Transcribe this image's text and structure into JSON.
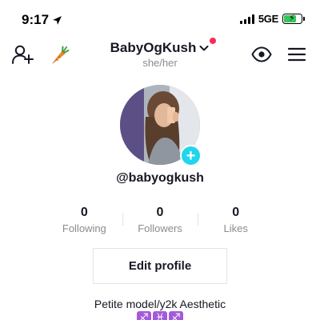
{
  "status_bar": {
    "time": "9:17",
    "network": "5GE",
    "battery_level": 0.7,
    "battery_color": "#34c759"
  },
  "header": {
    "username": "BabyOgKush",
    "pronouns": "she/her",
    "icons": [
      "add-friend-icon",
      "carrot-icon",
      "chevron-down-icon",
      "eye-icon",
      "menu-icon"
    ],
    "notification_dot_color": "#fe2c55"
  },
  "profile": {
    "handle": "@babyogkush",
    "add_avatar_color": "#20d5ec"
  },
  "stats": [
    {
      "value": "0",
      "label": "Following"
    },
    {
      "value": "0",
      "label": "Followers"
    },
    {
      "value": "0",
      "label": "Likes"
    }
  ],
  "actions": {
    "edit_profile_label": "Edit profile"
  },
  "bio": {
    "text": "Petite model/y2k Aesthetic",
    "zodiac": [
      "♐",
      "♓",
      "♐"
    ]
  }
}
